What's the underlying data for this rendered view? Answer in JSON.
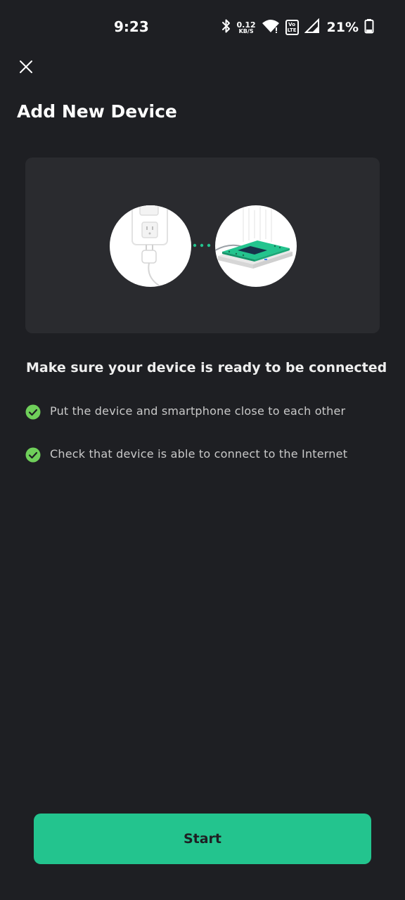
{
  "status_bar": {
    "time": "9:23",
    "net_speed_value": "0.12",
    "net_speed_unit": "KB/S",
    "volte_top": "Vo",
    "volte_bottom": "LTE",
    "battery_percent": "21%",
    "icons": [
      "bluetooth-icon",
      "wifi-icon",
      "volte-icon",
      "signal-icon",
      "battery-icon"
    ]
  },
  "header": {
    "close_icon": "close-icon",
    "title": "Add New Device"
  },
  "illustration": {
    "left_icon": "power-outlet-icon",
    "right_icon": "device-board-icon",
    "accent_color": "#23c48e"
  },
  "checklist": {
    "heading": "Make sure your device is ready to be connected",
    "items": [
      {
        "icon": "check-circle-icon",
        "text": "Put the device and smartphone close to each other"
      },
      {
        "icon": "check-circle-icon",
        "text": "Check that device is able to connect to the Internet"
      }
    ],
    "check_color": "#6fcf5a"
  },
  "actions": {
    "start_label": "Start",
    "button_color": "#23c48e"
  }
}
